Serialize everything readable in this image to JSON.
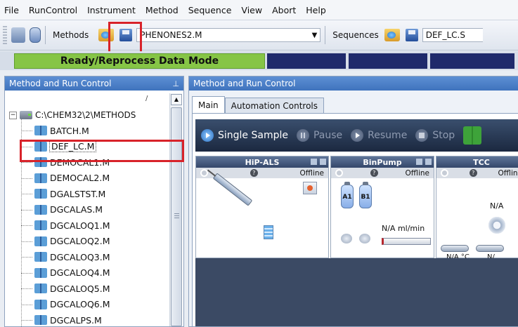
{
  "menu": [
    "File",
    "RunControl",
    "Instrument",
    "Method",
    "Sequence",
    "View",
    "Abort",
    "Help"
  ],
  "toolbar": {
    "methods_label": "Methods",
    "method_value": "PHENONES2.M",
    "sequences_label": "Sequences",
    "sequence_value": "DEF_LC.S"
  },
  "status": {
    "text": "Ready/Reprocess Data Mode",
    "color": "#86c546"
  },
  "left_panel": {
    "title": "Method and Run Control",
    "root_path": "C:\\CHEM32\\2\\METHODS",
    "path_hint": "/",
    "files": [
      "BATCH.M",
      "DEF_LC.M",
      "DEMOCAL1.M",
      "DEMOCAL2.M",
      "DGALSTST.M",
      "DGCALAS.M",
      "DGCALOQ1.M",
      "DGCALOQ2.M",
      "DGCALOQ3.M",
      "DGCALOQ4.M",
      "DGCALOQ5.M",
      "DGCALOQ6.M",
      "DGCALPS.M"
    ]
  },
  "right_panel": {
    "title": "Method and Run Control",
    "tabs": [
      "Main",
      "Automation Controls"
    ],
    "actions": {
      "single_sample": "Single Sample",
      "pause": "Pause",
      "resume": "Resume",
      "stop": "Stop"
    },
    "modules": [
      {
        "name": "HiP-ALS",
        "status": "Offline"
      },
      {
        "name": "BinPump",
        "status": "Offline",
        "bottle_a": "A1",
        "bottle_b": "B1",
        "flow": "N/A ml/min"
      },
      {
        "name": "TCC",
        "status": "Offline",
        "value": "N/A",
        "temp_left": "N/A °C",
        "temp_right": "N/"
      }
    ]
  },
  "highlight_color": "#d8232a"
}
